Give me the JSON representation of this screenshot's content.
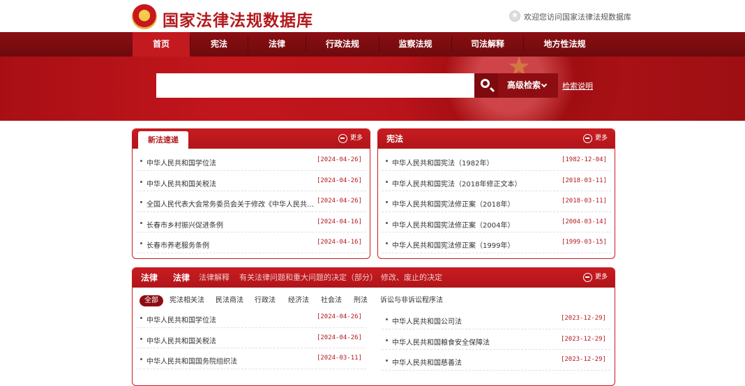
{
  "header": {
    "title": "国家法律法规数据库",
    "welcome": "欢迎您访问国家法律法规数据库"
  },
  "nav": {
    "items": [
      "首页",
      "宪法",
      "法律",
      "行政法规",
      "监察法规",
      "司法解释",
      "地方性法规"
    ],
    "active_index": 0
  },
  "search": {
    "value": "",
    "advanced_label": "高级检索",
    "help_label": "检索说明"
  },
  "colors": {
    "brand": "#b3191d",
    "nav_bg": "#7a0c10",
    "active_nav": "#c21a1f"
  },
  "more_label": "更多",
  "new_laws": {
    "tab": "新法速递",
    "items": [
      {
        "title": "中华人民共和国学位法",
        "date": "[2024-04-26]"
      },
      {
        "title": "中华人民共和国关税法",
        "date": "[2024-04-26]"
      },
      {
        "title": "全国人民代表大会常务委员会关于修改《中华人民共和…",
        "date": "[2024-04-26]"
      },
      {
        "title": "长春市乡村振兴促进条例",
        "date": "[2024-04-16]"
      },
      {
        "title": "长春市养老服务条例",
        "date": "[2024-04-16]"
      }
    ]
  },
  "constitution": {
    "title": "宪法",
    "items": [
      {
        "title": "中华人民共和国宪法（1982年）",
        "date": "[1982-12-04]"
      },
      {
        "title": "中华人民共和国宪法（2018年修正文本）",
        "date": "[2018-03-11]"
      },
      {
        "title": "中华人民共和国宪法修正案（2018年）",
        "date": "[2018-03-11]"
      },
      {
        "title": "中华人民共和国宪法修正案（2004年）",
        "date": "[2004-03-14]"
      },
      {
        "title": "中华人民共和国宪法修正案（1999年）",
        "date": "[1999-03-15]"
      }
    ]
  },
  "laws": {
    "title": "法律",
    "tabs": [
      "法律",
      "法律解释",
      "有关法律问题和重大问题的决定（部分）",
      "修改、废止的决定"
    ],
    "chips": [
      "全部",
      "宪法相关法",
      "民法商法",
      "行政法",
      "经济法",
      "社会法",
      "刑法",
      "诉讼与非诉讼程序法"
    ],
    "left_items": [
      {
        "title": "中华人民共和国学位法",
        "date": "[2024-04-26]"
      },
      {
        "title": "中华人民共和国关税法",
        "date": "[2024-04-26]"
      },
      {
        "title": "中华人民共和国国务院组织法",
        "date": "[2024-03-11]"
      }
    ],
    "right_items": [
      {
        "title": "中华人民共和国公司法",
        "date": "[2023-12-29]"
      },
      {
        "title": "中华人民共和国粮食安全保障法",
        "date": "[2023-12-29]"
      },
      {
        "title": "中华人民共和国慈善法",
        "date": "[2023-12-29]"
      }
    ]
  }
}
